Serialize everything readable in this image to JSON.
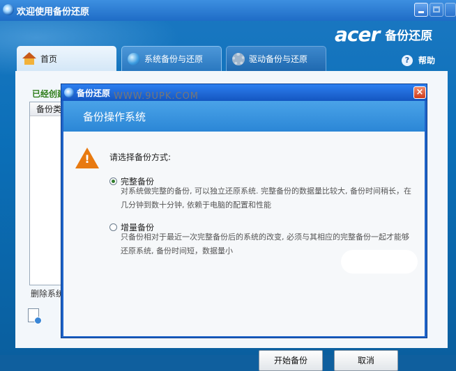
{
  "window": {
    "title": "欢迎使用备份还原"
  },
  "brand": {
    "logo": "acer",
    "product": "备份还原"
  },
  "tabs": [
    {
      "label": "首页"
    },
    {
      "label": "系统备份与还原"
    },
    {
      "label": "驱动备份与还原"
    }
  ],
  "help": {
    "label": "帮助",
    "icon": "?"
  },
  "background_panel": {
    "created_label": "已经创建",
    "column_header": "备份类",
    "delete_text": "删除系统"
  },
  "dialog": {
    "title": "备份还原",
    "header": "备份操作系统",
    "prompt": "请选择备份方式:",
    "watermark": "WWW.9UPK.COM",
    "options": [
      {
        "label": "完整备份",
        "selected": true,
        "desc_line1": "对系统做完整的备份, 可以独立还原系统. 完整备份的数据量比较大, 备份时间稍长，在",
        "desc_line2": "几分钟到数十分钟, 依赖于电脑的配置和性能"
      },
      {
        "label": "增量备份",
        "selected": false,
        "desc_line1": "只备份相对于最近一次完整备份后的系统的改变, 必须与其相应的完整备份一起才能够",
        "desc_line2": "还原系统, 备份时间短，数据量小"
      }
    ],
    "start_button": "开始备份",
    "cancel_button": "取消",
    "close_glyph": "×"
  }
}
